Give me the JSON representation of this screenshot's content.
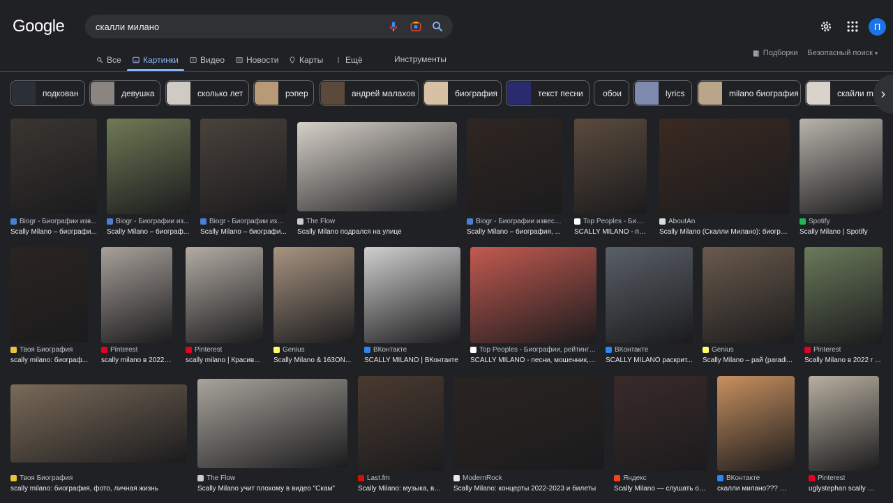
{
  "header": {
    "logo": "Google",
    "query": "скалли милано",
    "avatar_letter": "П"
  },
  "tabs": [
    {
      "label": "Все",
      "icon": "search-icon"
    },
    {
      "label": "Картинки",
      "icon": "images-icon",
      "active": true
    },
    {
      "label": "Видео",
      "icon": "video-icon"
    },
    {
      "label": "Новости",
      "icon": "news-icon"
    },
    {
      "label": "Карты",
      "icon": "map-pin-icon"
    },
    {
      "label": "Ещё",
      "icon": "more-vert-icon"
    }
  ],
  "tools_label": "Инструменты",
  "right_links": {
    "collections": "Подборки",
    "safe_search": "Безопасный поиск"
  },
  "chips": [
    {
      "label": "подкован",
      "color": "#2b2f36"
    },
    {
      "label": "девушка",
      "color": "#8a8580"
    },
    {
      "label": "сколько лет",
      "color": "#cfcac4"
    },
    {
      "label": "рэпер",
      "color": "#b89a78"
    },
    {
      "label": "андрей малахов",
      "color": "#5b4a3a"
    },
    {
      "label": "биография",
      "color": "#d8c0a4"
    },
    {
      "label": "текст песни",
      "color": "#2a2a6e"
    },
    {
      "label": "обои",
      "color": ""
    },
    {
      "label": "lyrics",
      "color": "#7f8ab0"
    },
    {
      "label": "milano биография",
      "color": "#b9a68a"
    },
    {
      "label": "скайли mil",
      "color": "#d9d3cc"
    }
  ],
  "results": [
    {
      "source": "Biogr - Биографии изв...",
      "title": "Scally Milano – биографи...",
      "fav": "#4a7fd6",
      "img": "#3a3530"
    },
    {
      "source": "Biogr - Биографии из...",
      "title": "Scally Milano – биограф...",
      "fav": "#4a7fd6",
      "img": "#6f7a55"
    },
    {
      "source": "Biogr - Биографии изве...",
      "title": "Scally Milano – биографи...",
      "fav": "#4a7fd6",
      "img": "#4a423c"
    },
    {
      "source": "The Flow",
      "title": "Scally Milano подрался на улице",
      "fav": "#cccccc",
      "img": "#d6d0c8"
    },
    {
      "source": "Biogr - Биографии извест...",
      "title": "Scally Milano – биография, ...",
      "fav": "#4a7fd6",
      "img": "#2f2622"
    },
    {
      "source": "Top Peoples - Биогр...",
      "title": "SCALLY MILANO - песн...",
      "fav": "#ffffff",
      "img": "#5a4a3c"
    },
    {
      "source": "AboutAn",
      "title": "Scally Milano (Скалли Милано): биогра...",
      "fav": "#dddddd",
      "img": "#3a2a22"
    },
    {
      "source": "Spotify",
      "title": "Scally Milano | Spotify",
      "fav": "#1db954",
      "img": "#b8b4ac"
    },
    {
      "source": "Твоя Биография",
      "title": "scally milano: биограф...",
      "fav": "#f0c040",
      "img": "#2a2420"
    },
    {
      "source": "Pinterest",
      "title": "scally milano в 2022 г |...",
      "fav": "#e60023",
      "img": "#a8a09a"
    },
    {
      "source": "Pinterest",
      "title": "scally milano | Красив...",
      "fav": "#e60023",
      "img": "#b3aca4"
    },
    {
      "source": "Genius",
      "title": "Scally Milano & 163ON...",
      "fav": "#ffff64",
      "img": "#a89480"
    },
    {
      "source": "ВКонтакте",
      "title": "SCALLY MILANO | ВКонтакте",
      "fav": "#2787f5",
      "img": "#cfcfcf"
    },
    {
      "source": "Top Peoples - Биографии, рейтинги...",
      "title": "SCALLY MILANO - песни, мошенник, ф...",
      "fav": "#ffffff",
      "img": "#c25a50"
    },
    {
      "source": "ВКонтакте",
      "title": "SCALLY MILANO раскрит...",
      "fav": "#2787f5",
      "img": "#5a6068"
    },
    {
      "source": "Genius",
      "title": "Scally Milano – рай (paradi...",
      "fav": "#ffff64",
      "img": "#6a5a4c"
    },
    {
      "source": "Pinterest",
      "title": "Scally Milano в 2022 г ...",
      "fav": "#e60023",
      "img": "#6a7a5a"
    },
    {
      "source": "Твоя Биография",
      "title": "scally milano: биография, фото, личная жизнь",
      "fav": "#f0c040",
      "img": "#7a6a58"
    },
    {
      "source": "The Flow",
      "title": "Scally Milano учит плохому в видео \"Скам\"",
      "fav": "#cccccc",
      "img": "#a8a49c"
    },
    {
      "source": "Last.fm",
      "title": "Scally Milano: музыка, ви...",
      "fav": "#d51007",
      "img": "#4a3a30"
    },
    {
      "source": "ModernRock",
      "title": "Scally Milano: концерты 2022-2023 и билеты",
      "fav": "#e8e8e8",
      "img": "#2a2420"
    },
    {
      "source": "Яндекс",
      "title": "Scally Milano — слушать он...",
      "fav": "#fc3f1d",
      "img": "#3a2a2a"
    },
    {
      "source": "ВКонтакте",
      "title": "скалли милано??? 😂 |...",
      "fav": "#2787f5",
      "img": "#c89060"
    },
    {
      "source": "Pinterest",
      "title": "uglystephan scally milano...",
      "fav": "#e60023",
      "img": "#b8b0a0"
    }
  ]
}
